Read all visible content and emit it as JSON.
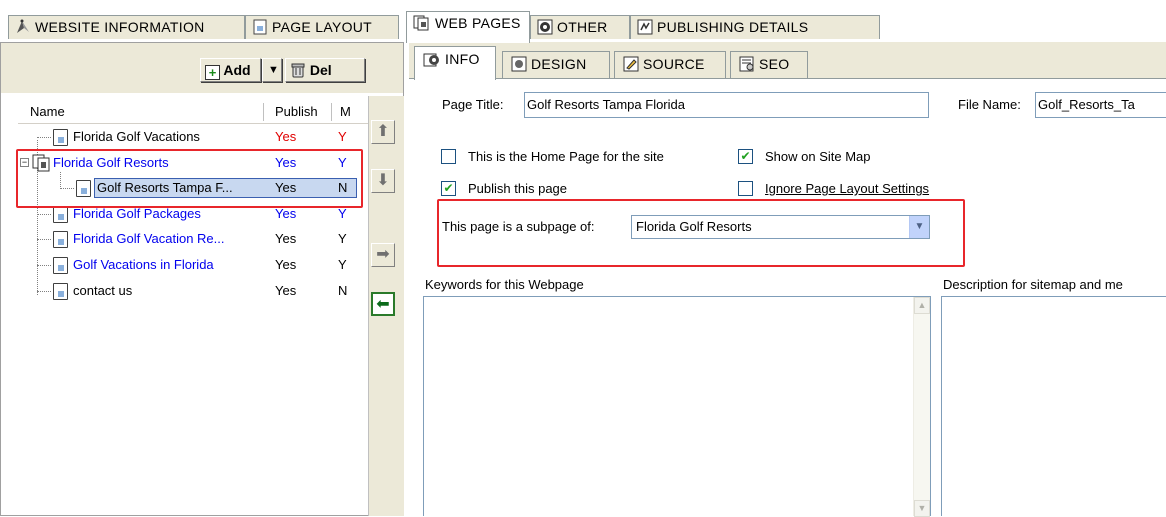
{
  "top_tabs": [
    {
      "label": "WEBSITE INFORMATION",
      "icon": "compass-icon"
    },
    {
      "label": "PAGE LAYOUT",
      "icon": "page-icon"
    },
    {
      "label": "WEB PAGES",
      "icon": "pages-icon"
    },
    {
      "label": "OTHER",
      "icon": "gear-icon"
    },
    {
      "label": "PUBLISHING DETAILS",
      "icon": "details-icon"
    }
  ],
  "active_top_tab": "WEB PAGES",
  "left_toolbar": {
    "add_label": "Add",
    "del_label": "Del"
  },
  "page_list": {
    "columns": [
      "Name",
      "Publish",
      "M"
    ],
    "rows": [
      {
        "name": "Florida Golf Vacations",
        "publish": "Yes",
        "m": "Y",
        "color": "black",
        "publish_color": "red"
      },
      {
        "name": "Florida Golf Resorts",
        "publish": "Yes",
        "m": "Y",
        "color": "blue",
        "publish_color": "blue"
      },
      {
        "name": "Golf Resorts Tampa F...",
        "publish": "Yes",
        "m": "N",
        "color": "black",
        "publish_color": "black",
        "selected": true
      },
      {
        "name": "Florida Golf Packages",
        "publish": "Yes",
        "m": "Y",
        "color": "blue",
        "publish_color": "blue"
      },
      {
        "name": "Florida Golf Vacation Re...",
        "publish": "Yes",
        "m": "Y",
        "color": "blue",
        "publish_color": "black"
      },
      {
        "name": "Golf Vacations in Florida",
        "publish": "Yes",
        "m": "Y",
        "color": "blue",
        "publish_color": "black"
      },
      {
        "name": "contact us",
        "publish": "Yes",
        "m": "N",
        "color": "black",
        "publish_color": "black"
      }
    ]
  },
  "sub_tabs": [
    "INFO",
    "DESIGN",
    "SOURCE",
    "SEO"
  ],
  "active_sub_tab": "INFO",
  "form": {
    "page_title_label": "Page Title:",
    "page_title_value": "Golf Resorts Tampa Florida",
    "file_name_label": "File Name:",
    "file_name_value": "Golf_Resorts_Ta",
    "home_page_label": "This is the Home Page for the site",
    "home_page_checked": false,
    "site_map_label": "Show on Site Map",
    "site_map_checked": true,
    "publish_label": "Publish this page",
    "publish_checked": true,
    "ignore_layout_label": "Ignore Page Layout Settings",
    "ignore_layout_checked": false,
    "subpage_label": "This page is a subpage of:",
    "subpage_value": "Florida Golf Resorts",
    "keywords_label": "Keywords for this Webpage",
    "description_label": "Description for sitemap and me"
  },
  "colors": {
    "highlight": "#e8262b",
    "link": "#0000ee",
    "selection": "#c8d8f0",
    "tab_bg": "#ece9d8"
  }
}
